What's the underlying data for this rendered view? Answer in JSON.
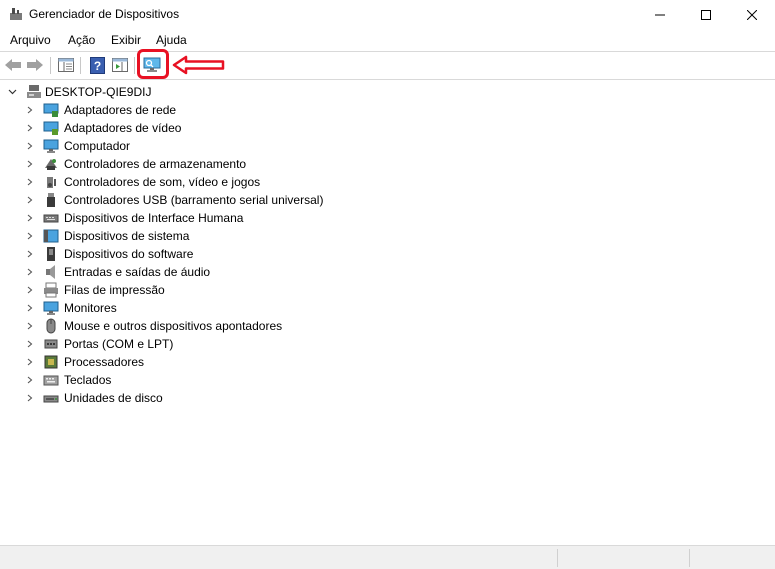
{
  "window": {
    "title": "Gerenciador de Dispositivos",
    "controls": [
      "minimize-icon",
      "maximize-icon",
      "close-icon"
    ]
  },
  "menu": {
    "items": [
      "Arquivo",
      "Ação",
      "Exibir",
      "Ajuda"
    ]
  },
  "toolbar": {
    "buttons": [
      "back-arrow-icon",
      "forward-arrow-icon",
      "properties-pane-icon",
      "help-icon",
      "action-pane-icon",
      "scan-hardware-changes-icon"
    ],
    "highlighted_button": "scan-hardware-changes-icon",
    "highlight_color": "#e81123"
  },
  "tree": {
    "root": "DESKTOP-QIE9DIJ",
    "categories": [
      {
        "label": "Adaptadores de rede",
        "icon": "network-adapter-icon"
      },
      {
        "label": "Adaptadores de vídeo",
        "icon": "display-adapter-icon"
      },
      {
        "label": "Computador",
        "icon": "computer-icon"
      },
      {
        "label": "Controladores de armazenamento",
        "icon": "storage-controller-icon"
      },
      {
        "label": "Controladores de som, vídeo e jogos",
        "icon": "sound-icon"
      },
      {
        "label": "Controladores USB (barramento serial universal)",
        "icon": "usb-icon"
      },
      {
        "label": "Dispositivos de Interface Humana",
        "icon": "hid-icon"
      },
      {
        "label": "Dispositivos de sistema",
        "icon": "system-device-icon"
      },
      {
        "label": "Dispositivos do software",
        "icon": "software-device-icon"
      },
      {
        "label": "Entradas e saídas de áudio",
        "icon": "audio-io-icon"
      },
      {
        "label": "Filas de impressão",
        "icon": "print-queue-icon"
      },
      {
        "label": "Monitores",
        "icon": "monitor-icon"
      },
      {
        "label": "Mouse e outros dispositivos apontadores",
        "icon": "mouse-icon"
      },
      {
        "label": "Portas (COM e LPT)",
        "icon": "port-icon"
      },
      {
        "label": "Processadores",
        "icon": "processor-icon"
      },
      {
        "label": "Teclados",
        "icon": "keyboard-icon"
      },
      {
        "label": "Unidades de disco",
        "icon": "disk-drive-icon"
      }
    ]
  }
}
